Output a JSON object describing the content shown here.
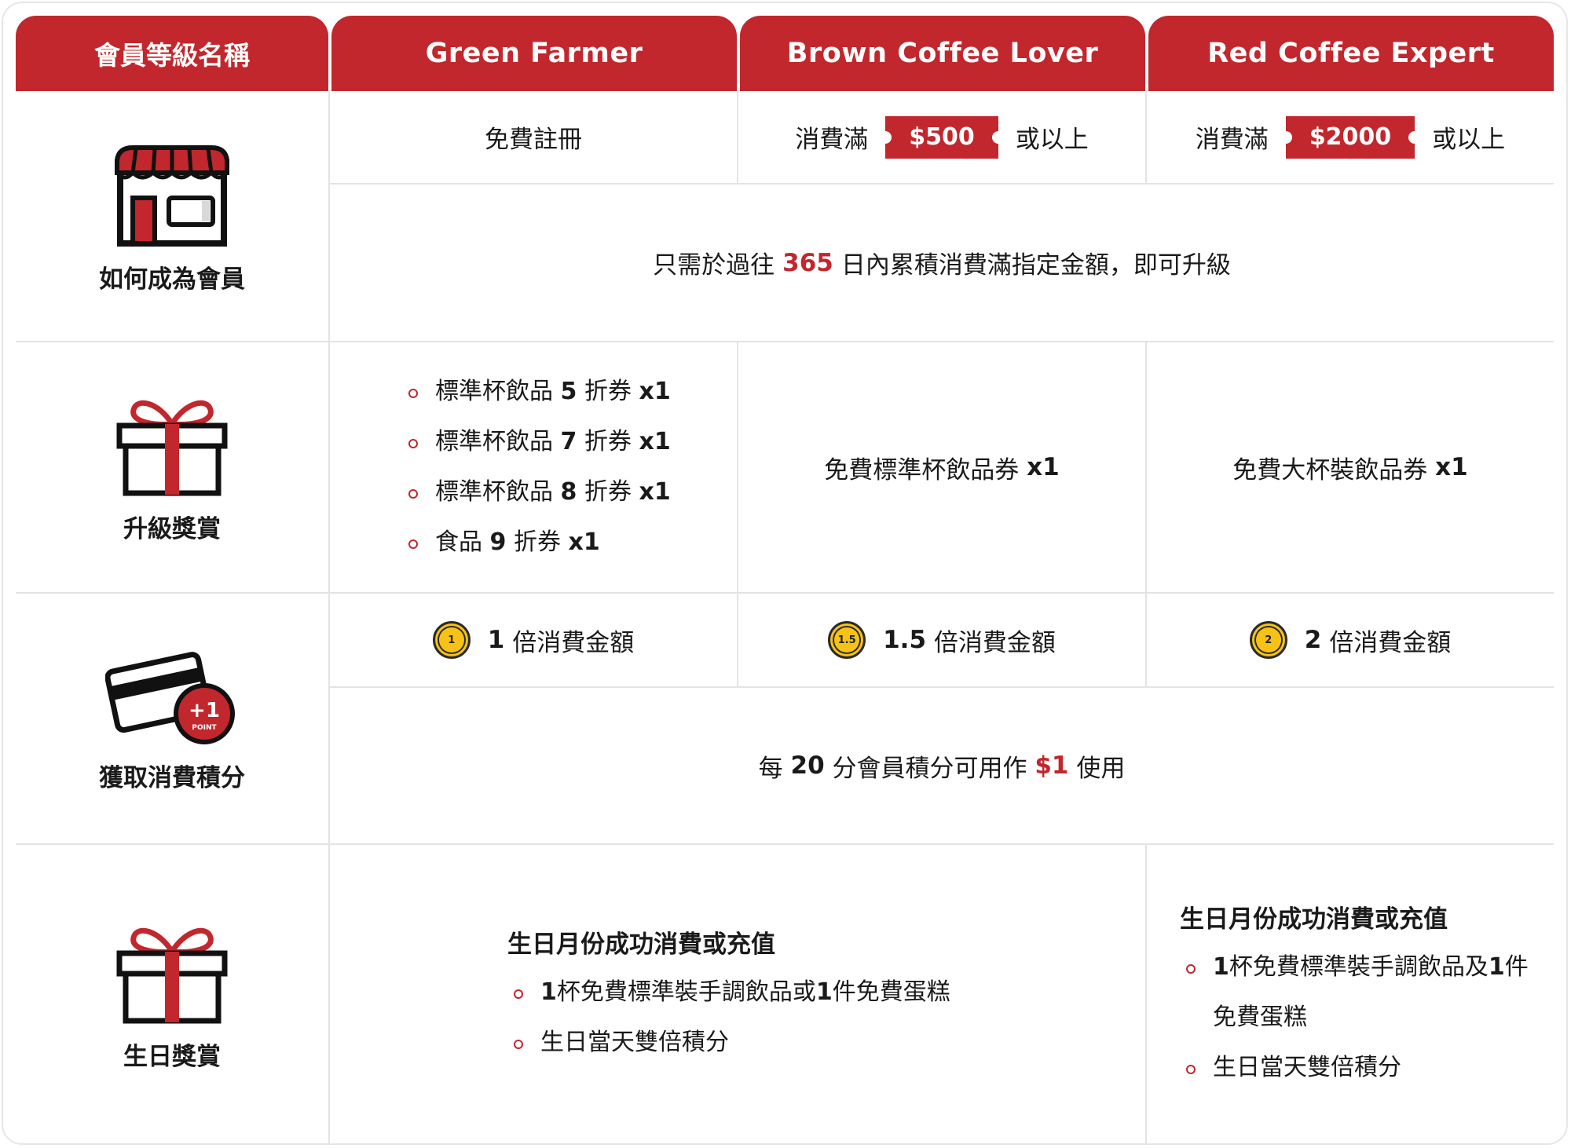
{
  "header": {
    "first": "會員等級名稱",
    "tiers": [
      "Green Farmer",
      "Brown Coffee Lover",
      "Red Coffee Expert"
    ]
  },
  "rows": {
    "join": {
      "label": "如何成為會員",
      "icon": "store-icon",
      "green": "免費註冊",
      "brown": {
        "prefix": "消費滿",
        "amount": "$500",
        "suffix": "或以上"
      },
      "red": {
        "prefix": "消費滿",
        "amount": "$2000",
        "suffix": "或以上"
      },
      "note": {
        "pre": "只需於過往",
        "days": "365",
        "post": "日內累積消費滿指定金額，即可升級"
      }
    },
    "upgrade": {
      "label": "升級獎賞",
      "icon": "gift-icon",
      "green": [
        {
          "text": "標準杯飲品",
          "num": "5",
          "unit": "折券",
          "qty": "x1"
        },
        {
          "text": "標準杯飲品",
          "num": "7",
          "unit": "折券",
          "qty": "x1"
        },
        {
          "text": "標準杯飲品",
          "num": "8",
          "unit": "折券",
          "qty": "x1"
        },
        {
          "text": "食品",
          "num": "9",
          "unit": "折券",
          "qty": "x1"
        }
      ],
      "brown": {
        "text": "免費標準杯飲品券",
        "qty": "x1"
      },
      "red": {
        "text": "免費大杯裝飲品券",
        "qty": "x1"
      }
    },
    "points": {
      "label": "獲取消費積分",
      "icon": "card-point-icon",
      "icon_badge": "+1",
      "icon_badge_sub": "POINT",
      "green": {
        "coin": "1",
        "num": "1",
        "text": "倍消費金額"
      },
      "brown": {
        "coin": "1.5",
        "num": "1.5",
        "text": "倍消費金額"
      },
      "red": {
        "coin": "2",
        "num": "2",
        "text": "倍消費金額"
      },
      "note": {
        "pre": "每",
        "num": "20",
        "mid": "分會員積分可用作",
        "amount": "$1",
        "post": "使用"
      }
    },
    "birthday": {
      "label": "生日獎賞",
      "icon": "gift-icon",
      "left": {
        "title": "生日月份成功消費或充值",
        "item1": {
          "a": "1",
          "b": "杯免費標準裝手調飲品或",
          "c": "1",
          "d": "件免費蛋糕"
        },
        "item2": "生日當天雙倍積分"
      },
      "right": {
        "title": "生日月份成功消費或充值",
        "item1": {
          "a": "1",
          "b": "杯免費標準裝手調飲品及",
          "c": "1",
          "d": "件免費蛋糕"
        },
        "item2": "生日當天雙倍積分"
      }
    }
  },
  "colors": {
    "brand_red": "#c1272d",
    "coin_yellow": "#f7c218",
    "border": "#e3e3e3"
  }
}
